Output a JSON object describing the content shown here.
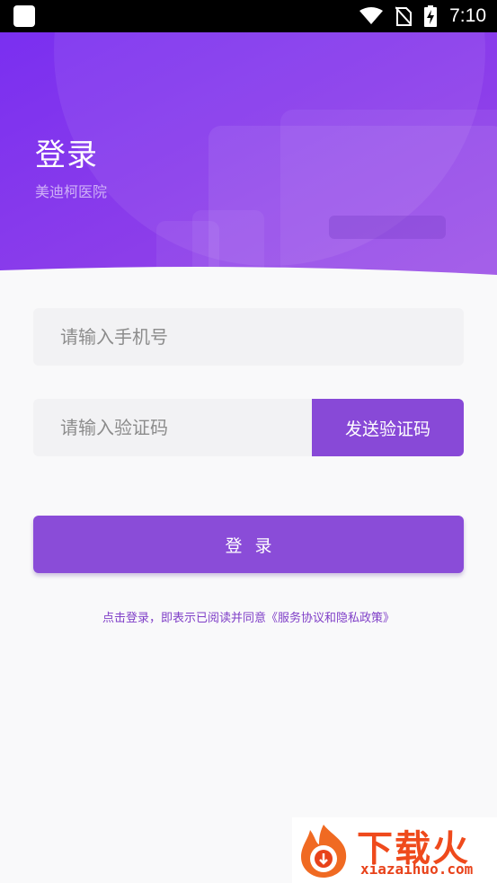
{
  "status_bar": {
    "time": "7:10"
  },
  "header": {
    "title": "登录",
    "subtitle": "美迪柯医院"
  },
  "form": {
    "phone_placeholder": "请输入手机号",
    "code_placeholder": "请输入验证码",
    "send_code_label": "发送验证码",
    "login_label": "登录"
  },
  "agreement_text": "点击登录，即表示已阅读并同意《服务协议和隐私政策》",
  "watermark": {
    "title": "下载火",
    "url": "xiazaihuo.com"
  },
  "colors": {
    "accent": "#8849d7",
    "header_gradient_start": "#7b2ff0",
    "header_gradient_end": "#9a4ee0"
  }
}
